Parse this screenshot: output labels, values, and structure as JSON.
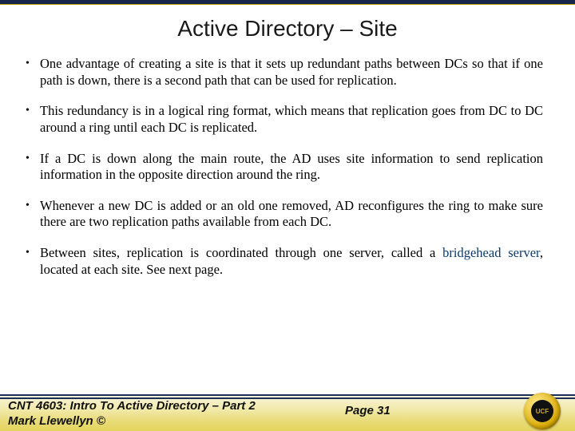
{
  "title": "Active Directory – Site",
  "bullets": [
    "One advantage of creating a site is that it sets up redundant paths between DCs so that if one path is down, there is a second path that can be used for replication.",
    "This redundancy is in a logical ring format, which means that replication goes from DC to DC around a ring until each DC is replicated.",
    "If a DC is down along the main route, the AD uses site information to send replication information in the opposite direction around the ring.",
    "Whenever a new DC is added or an old one removed, AD reconfigures the ring to make sure there are two replication paths available from each DC.",
    "Between sites, replication is coordinated through one server, called a <span class=\"kw\">bridgehead server</span>, located at each site.  See next page."
  ],
  "footer": {
    "course": "CNT 4603: Intro To Active Directory – Part 2",
    "author": "Mark Llewellyn ©",
    "page_label": "Page 31"
  }
}
